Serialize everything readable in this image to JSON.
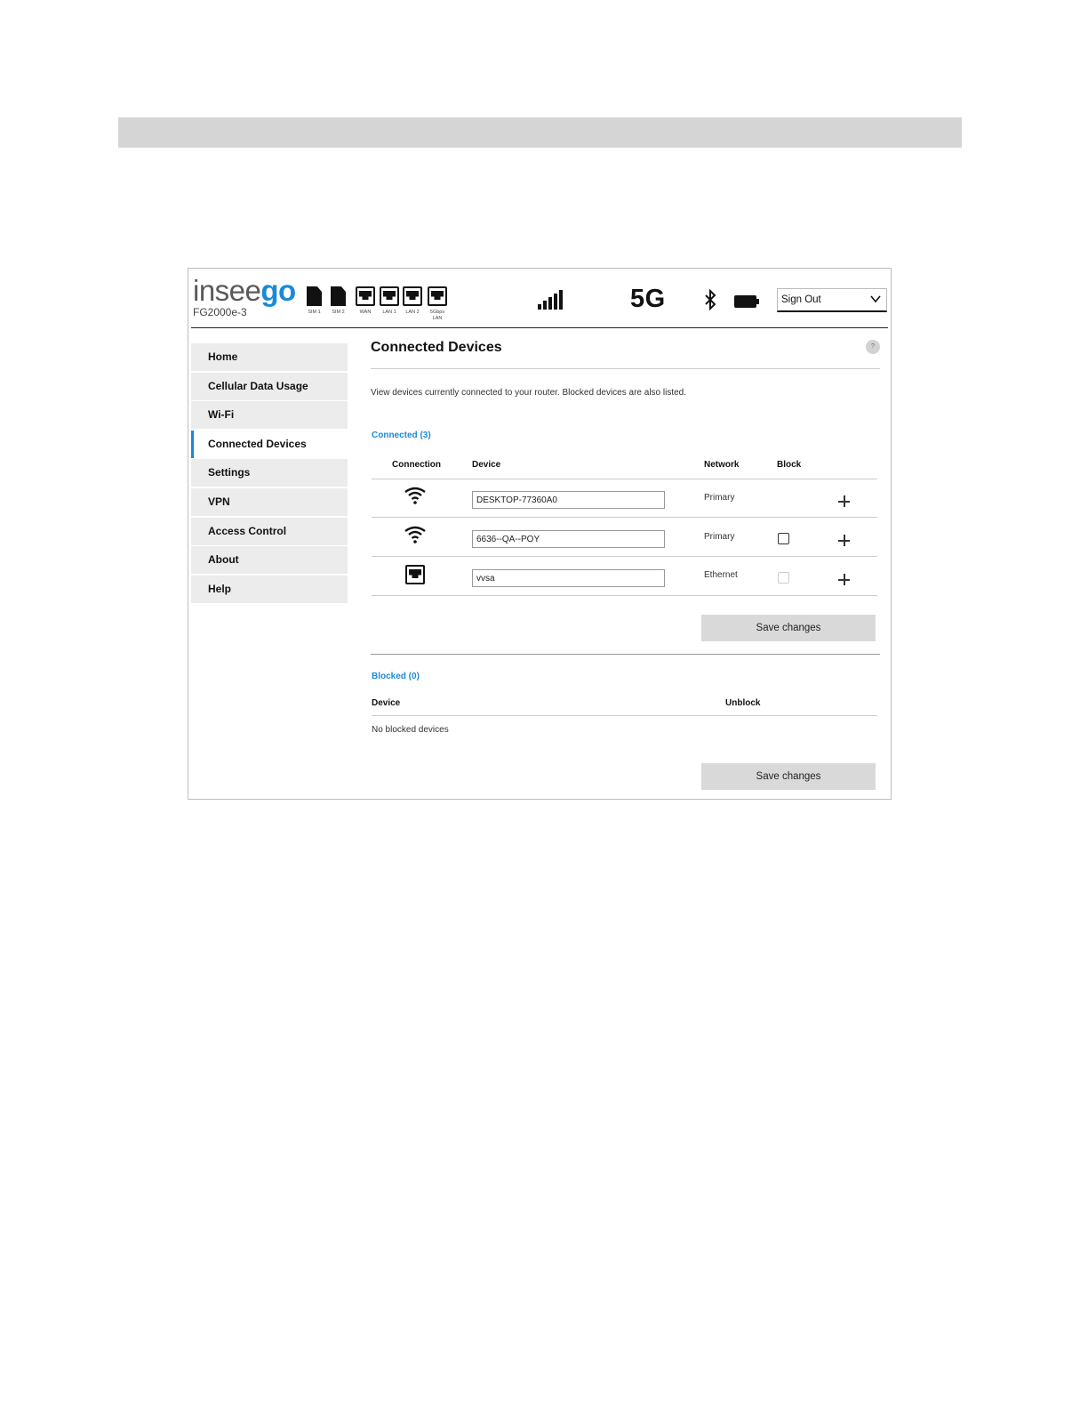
{
  "header": {
    "logo_part1": "insee",
    "logo_part2": "go",
    "model": "FG2000e-3",
    "ports": [
      "SIM 1",
      "SIM 2",
      "WAN",
      "LAN 1",
      "LAN 2",
      "5Gbps LAN"
    ],
    "network_type": "5G",
    "signout_label": "Sign Out",
    "icons": [
      "sim-card-icon",
      "ethernet-port-icon",
      "signal-strength-icon",
      "bluetooth-icon",
      "battery-icon",
      "chevron-down-icon"
    ]
  },
  "sidebar": {
    "items": [
      {
        "label": "Home"
      },
      {
        "label": "Cellular Data Usage"
      },
      {
        "label": "Wi-Fi"
      },
      {
        "label": "Connected Devices"
      },
      {
        "label": "Settings"
      },
      {
        "label": "VPN"
      },
      {
        "label": "Access Control"
      },
      {
        "label": "About"
      },
      {
        "label": "Help"
      }
    ],
    "active_index": 3
  },
  "main": {
    "title": "Connected Devices",
    "help_symbol": "?",
    "description": "View devices currently connected to your router. Blocked devices are also listed.",
    "connected": {
      "label": "Connected (3)",
      "headers": {
        "connection": "Connection",
        "device": "Device",
        "network": "Network",
        "block": "Block"
      },
      "rows": [
        {
          "connection": "wifi",
          "device": "DESKTOP-77360A0",
          "network": "Primary",
          "block": "none"
        },
        {
          "connection": "wifi",
          "device": "6636--QA--POY",
          "network": "Primary",
          "block": "unchecked"
        },
        {
          "connection": "ethernet",
          "device": "vvsa",
          "network": "Ethernet",
          "block": "disabled"
        }
      ],
      "save_label": "Save changes"
    },
    "blocked": {
      "label": "Blocked (0)",
      "headers": {
        "device": "Device",
        "unblock": "Unblock"
      },
      "empty_text": "No blocked devices",
      "save_label": "Save changes"
    }
  },
  "colors": {
    "accent": "#1b8ad6",
    "nav_bg": "#ececec",
    "button_bg": "#d9d9d9",
    "band": "#d5d5d5"
  }
}
